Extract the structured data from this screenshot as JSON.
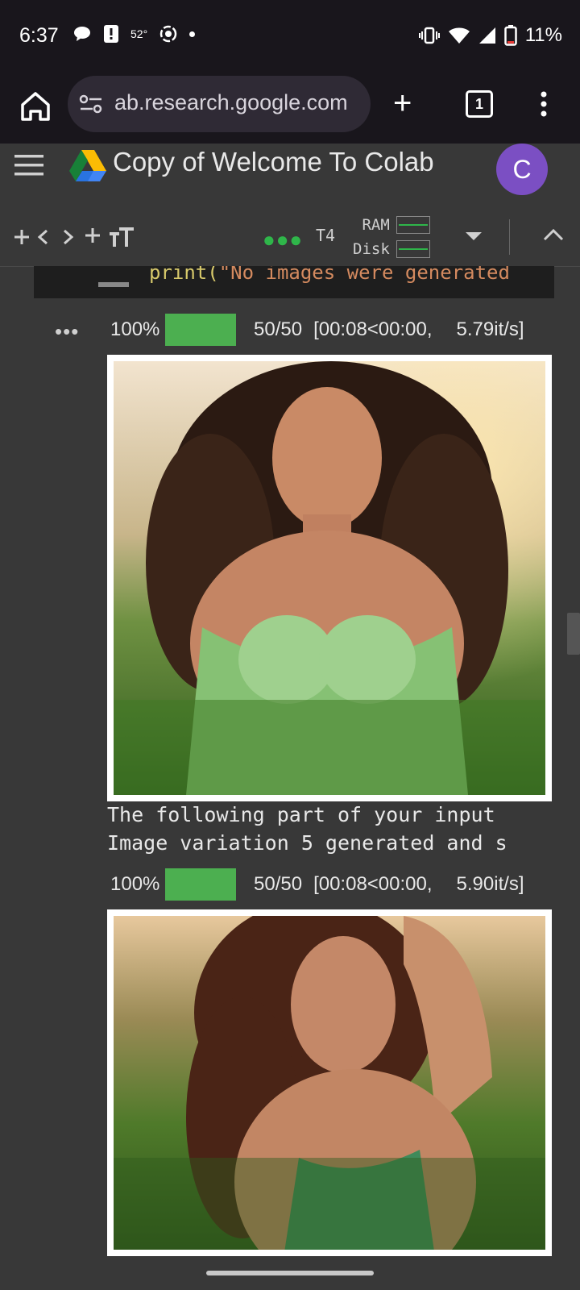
{
  "status_bar": {
    "time": "6:37",
    "temperature": "52°",
    "battery": "11%"
  },
  "browser": {
    "url": "ab.research.google.com",
    "tab_count": "1"
  },
  "colab": {
    "title": "Copy of Welcome To Colab",
    "avatar_letter": "C"
  },
  "toolbar": {
    "runtime": "T4",
    "ram_label": "RAM",
    "disk_label": "Disk"
  },
  "cell": {
    "code_fn": "print(",
    "code_str": "\"No images were generated"
  },
  "outputs": {
    "progress1": {
      "percent": "100%",
      "count": "50/50",
      "timing": "[00:08<00:00,",
      "rate": "5.79it/s]"
    },
    "text_line1": "The following part of your input",
    "text_line2": "Image variation 5 generated and s",
    "progress2": {
      "percent": "100%",
      "count": "50/50",
      "timing": "[00:08<00:00,",
      "rate": "5.90it/s]"
    }
  },
  "icons": [
    "home-icon",
    "tune-icon",
    "new-tab-icon",
    "tabs-icon",
    "more-vert-icon",
    "hamburger-icon",
    "drive-icon",
    "add-code-icon",
    "add-text-icon",
    "chevron-up-icon",
    "caret-down-icon"
  ]
}
